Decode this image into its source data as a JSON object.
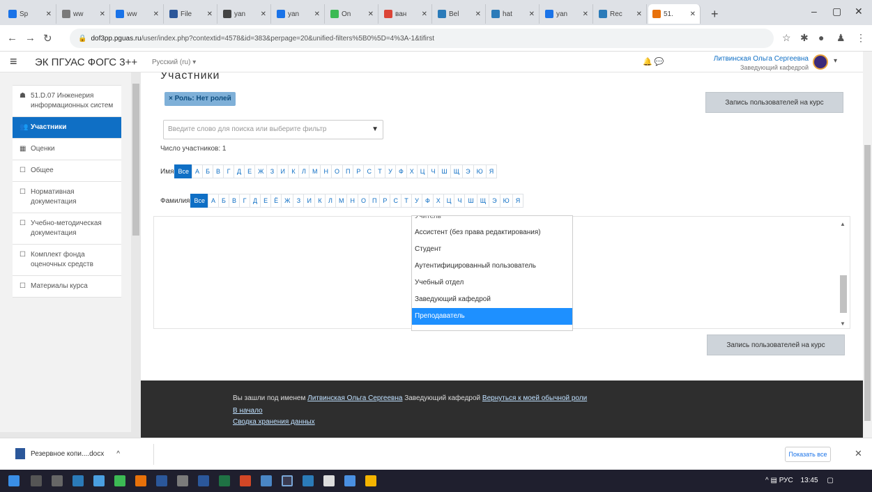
{
  "browser": {
    "tabs": [
      {
        "label": "Sp",
        "color": "#1a73e8"
      },
      {
        "label": "ww",
        "color": "#7a7a7a"
      },
      {
        "label": "ww",
        "color": "#1a73e8"
      },
      {
        "label": "File",
        "color": "#2b579a"
      },
      {
        "label": "yan",
        "color": "#444"
      },
      {
        "label": "yan",
        "color": "#1a73e8"
      },
      {
        "label": "On",
        "color": "#3cba54"
      },
      {
        "label": "ван",
        "color": "#db4437"
      },
      {
        "label": "Bel",
        "color": "#2b7bb9"
      },
      {
        "label": "hat",
        "color": "#2b7bb9"
      },
      {
        "label": "yan",
        "color": "#1a73e8"
      },
      {
        "label": "Rec",
        "color": "#2b7bb9"
      },
      {
        "label": "51.",
        "color": "#e8710a"
      }
    ],
    "url_host": "dof3pp.pguas.ru",
    "url_path": "/user/index.php?contextid=4578&id=383&perpage=20&unified-filters%5B0%5D=4%3A-1&tifirst"
  },
  "header": {
    "site_name": "ЭК ПГУАС ФОГС 3++",
    "language": "Русский (ru) ▾",
    "user_name": "Литвинская Ольга Сергеевна",
    "user_role": "Заведующий кафедрой"
  },
  "drawer": {
    "items": [
      {
        "icon": "☗",
        "label": "51.D.07 Инженерия информационных систем",
        "active": false
      },
      {
        "icon": "👥",
        "label": "Участники",
        "active": true
      },
      {
        "icon": "▦",
        "label": "Оценки",
        "active": false
      },
      {
        "icon": "☐",
        "label": "Общее",
        "active": false
      },
      {
        "icon": "☐",
        "label": "Нормативная документация",
        "active": false
      },
      {
        "icon": "☐",
        "label": "Учебно-методическая документация",
        "active": false
      },
      {
        "icon": "☐",
        "label": "Комплект фонда оценочных средств",
        "active": false
      },
      {
        "icon": "☐",
        "label": "Материалы курса",
        "active": false
      }
    ]
  },
  "main": {
    "heading": "Участники",
    "role_chip": "× Роль: Нет ролей",
    "enrol_button": "Запись пользователей на курс",
    "filter_placeholder": "Введите слово для поиска или выберите фильтр",
    "participant_count": "Число участников: 1",
    "firstname_label": "Имя",
    "lastname_label": "Фамилия",
    "all_label": "Все",
    "firstname_letters": [
      "А",
      "Б",
      "В",
      "Г",
      "Д",
      "Е",
      "Ж",
      "З",
      "И",
      "К",
      "Л",
      "М",
      "Н",
      "О",
      "П",
      "Р",
      "С",
      "Т",
      "У",
      "Ф",
      "Х",
      "Ц",
      "Ч",
      "Ш",
      "Щ",
      "Э",
      "Ю",
      "Я"
    ],
    "lastname_letters": [
      "А",
      "Б",
      "В",
      "Г",
      "Д",
      "Е",
      "Ё",
      "Ж",
      "З",
      "И",
      "К",
      "Л",
      "М",
      "Н",
      "О",
      "П",
      "Р",
      "С",
      "Т",
      "У",
      "Ф",
      "Х",
      "Ц",
      "Ч",
      "Ш",
      "Щ",
      "Э",
      "Ю",
      "Я"
    ]
  },
  "dropdown": {
    "options": [
      {
        "label": "Учитель",
        "state": "cut"
      },
      {
        "label": "Ассистент (без права редактирования)",
        "state": ""
      },
      {
        "label": "Студент",
        "state": ""
      },
      {
        "label": "Аутентифицированный пользователь",
        "state": ""
      },
      {
        "label": "Учебный отдел",
        "state": ""
      },
      {
        "label": "Заведующий кафедрой",
        "state": ""
      },
      {
        "label": "Преподаватель",
        "state": "sel"
      }
    ]
  },
  "footer": {
    "logged_prefix": "Вы зашли под именем",
    "logged_user": "Литвинская Ольга Сергеевна",
    "logged_role": "Заведующий кафедрой",
    "return_link": "Вернуться к моей обычной роли",
    "home_link": "В начало",
    "data_link": "Сводка хранения данных"
  },
  "downloads": {
    "file": "Резервное копи....docx",
    "show_all": "Показать все"
  },
  "taskbar": {
    "lang": "РУС",
    "time": "13:45"
  },
  "colors": {
    "accent": "#0f6fc5",
    "selected_option": "#1e90ff",
    "footer_bg": "#2e2e2e"
  }
}
